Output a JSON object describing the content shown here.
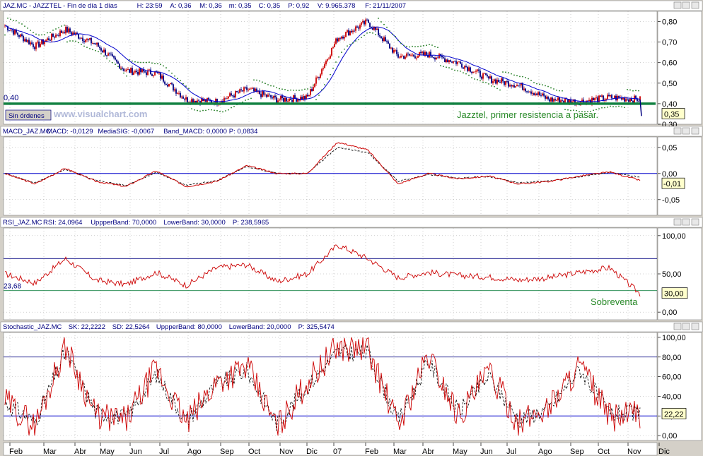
{
  "colors": {
    "candle_up": "#cc0000",
    "candle_down": "#000080",
    "blue_line": "#0000cc",
    "green_line": "#1e7a1e",
    "support": "#108040",
    "red_line": "#cc0000",
    "header_bg": "#ffffff",
    "header_text": "#000080",
    "axis_bg": "#ffffff",
    "grid": "#a0a0a0"
  },
  "panels": [
    {
      "id": "price",
      "header": [
        "JAZ.MC - JAZZTEL - Fin de día 1 días",
        "H: 23:59",
        "A: 0,36",
        "M: 0,36",
        "m: 0,35",
        "C: 0,35",
        "P: 0,92",
        "V: 9.965.378",
        "F: 21/11/2007"
      ],
      "ticks": [
        "0,80",
        "0,70",
        "0,60",
        "0,50",
        "0,40",
        "0,30"
      ],
      "badge": "0,35",
      "left_label": "0,40",
      "annotation": "Jazztel, primer resistencia a pasar.",
      "button": "Sin órdenes",
      "watermark": "www.visualchart.com"
    },
    {
      "id": "macd",
      "header": [
        "MACD_JAZ.MC",
        "MACD: -0,0129",
        "MediaSIG: -0,0067",
        "Band_MACD: 0,0000",
        "P: 0,0834"
      ],
      "ticks": [
        "0,05",
        "0,00",
        "-0,05"
      ],
      "badge": "-0,01"
    },
    {
      "id": "rsi",
      "header": [
        "RSI_JAZ.MC",
        "RSI: 24,0964",
        "UppperBand: 70,0000",
        "LowerBand: 30,0000",
        "P: 238,5965"
      ],
      "ticks": [
        "100,00",
        "50,00",
        "0,00"
      ],
      "badge": "30,00",
      "left_label": "23,68",
      "annotation": "Sobreventa"
    },
    {
      "id": "stoch",
      "header": [
        "Stochastic_JAZ.MC",
        "SK: 22,2222",
        "SD: 22,5264",
        "UppperBand: 80,0000",
        "LowerBand: 20,0000",
        "P: 325,5474"
      ],
      "ticks": [
        "100,00",
        "80,00",
        "60,00",
        "40,00",
        "20,00",
        "0,00"
      ],
      "badge": "22,22"
    }
  ],
  "months": [
    "Feb",
    "Mar",
    "Abr",
    "May",
    "Jun",
    "Jul",
    "Ago",
    "Sep",
    "Oct",
    "Nov",
    "Dic",
    "07",
    "Feb",
    "Mar",
    "Abr",
    "May",
    "Jun",
    "Jul",
    "Ago",
    "Sep",
    "Oct",
    "Nov",
    "Dic"
  ],
  "chart_data": [
    {
      "type": "line",
      "title": "JAZ.MC - JAZZTEL",
      "note": "Daily candlestick price chart",
      "ylim": [
        0.3,
        0.85
      ],
      "x": [
        "Feb",
        "Mar",
        "Abr",
        "May",
        "Jun",
        "Jul",
        "Ago",
        "Sep",
        "Oct",
        "Nov",
        "Dic",
        "07",
        "Feb",
        "Mar",
        "Abr",
        "May",
        "Jun",
        "Jul",
        "Ago",
        "Sep",
        "Oct",
        "Nov"
      ],
      "series": [
        {
          "name": "close",
          "values": [
            0.78,
            0.68,
            0.76,
            0.69,
            0.56,
            0.55,
            0.42,
            0.41,
            0.47,
            0.42,
            0.43,
            0.72,
            0.8,
            0.63,
            0.64,
            0.6,
            0.52,
            0.49,
            0.42,
            0.41,
            0.43,
            0.42
          ]
        }
      ],
      "support_level": 0.4,
      "last_close": 0.35
    },
    {
      "type": "line",
      "title": "MACD_JAZ.MC",
      "ylim": [
        -0.08,
        0.07
      ],
      "x": [
        "Feb",
        "Mar",
        "Abr",
        "May",
        "Jun",
        "Jul",
        "Ago",
        "Sep",
        "Oct",
        "Nov",
        "Dic",
        "07",
        "Feb",
        "Mar",
        "Abr",
        "May",
        "Jun",
        "Jul",
        "Ago",
        "Sep",
        "Oct",
        "Nov"
      ],
      "series": [
        {
          "name": "MACD",
          "values": [
            0.0,
            -0.02,
            0.01,
            -0.015,
            -0.025,
            0.005,
            -0.025,
            -0.015,
            0.015,
            0.0,
            0.0,
            0.06,
            0.045,
            -0.02,
            0.0,
            -0.01,
            -0.005,
            -0.02,
            -0.015,
            -0.005,
            0.003,
            -0.013
          ]
        },
        {
          "name": "MediaSIG",
          "values": [
            0.0,
            -0.018,
            0.008,
            -0.013,
            -0.023,
            0.002,
            -0.022,
            -0.014,
            0.013,
            0.0,
            0.0,
            0.05,
            0.04,
            -0.015,
            -0.002,
            -0.009,
            -0.006,
            -0.018,
            -0.014,
            -0.006,
            0.002,
            -0.007
          ]
        }
      ],
      "band": 0.0
    },
    {
      "type": "line",
      "title": "RSI_JAZ.MC",
      "ylim": [
        -10,
        110
      ],
      "x": [
        "Feb",
        "Mar",
        "Abr",
        "May",
        "Jun",
        "Jul",
        "Ago",
        "Sep",
        "Oct",
        "Nov",
        "Dic",
        "07",
        "Feb",
        "Mar",
        "Abr",
        "May",
        "Jun",
        "Jul",
        "Ago",
        "Sep",
        "Oct",
        "Nov"
      ],
      "series": [
        {
          "name": "RSI",
          "values": [
            50,
            38,
            70,
            42,
            36,
            52,
            35,
            58,
            62,
            40,
            50,
            88,
            70,
            45,
            52,
            48,
            46,
            42,
            45,
            52,
            58,
            24
          ]
        }
      ],
      "upper_band": 70,
      "lower_band": 30
    },
    {
      "type": "line",
      "title": "Stochastic_JAZ.MC",
      "ylim": [
        -5,
        105
      ],
      "x": [
        "Feb",
        "Mar",
        "Abr",
        "May",
        "Jun",
        "Jul",
        "Ago",
        "Sep",
        "Oct",
        "Nov",
        "Dic",
        "07",
        "Feb",
        "Mar",
        "Abr",
        "May",
        "Jun",
        "Jul",
        "Ago",
        "Sep",
        "Oct",
        "Nov"
      ],
      "series": [
        {
          "name": "SK",
          "values": [
            35,
            10,
            92,
            20,
            15,
            68,
            12,
            55,
            70,
            8,
            55,
            90,
            88,
            10,
            82,
            20,
            65,
            12,
            30,
            72,
            18,
            22
          ]
        },
        {
          "name": "SD",
          "values": [
            33,
            14,
            85,
            24,
            18,
            62,
            15,
            52,
            66,
            12,
            50,
            85,
            84,
            15,
            75,
            24,
            60,
            16,
            28,
            68,
            22,
            22.5
          ]
        }
      ],
      "upper_band": 80,
      "lower_band": 20
    }
  ]
}
